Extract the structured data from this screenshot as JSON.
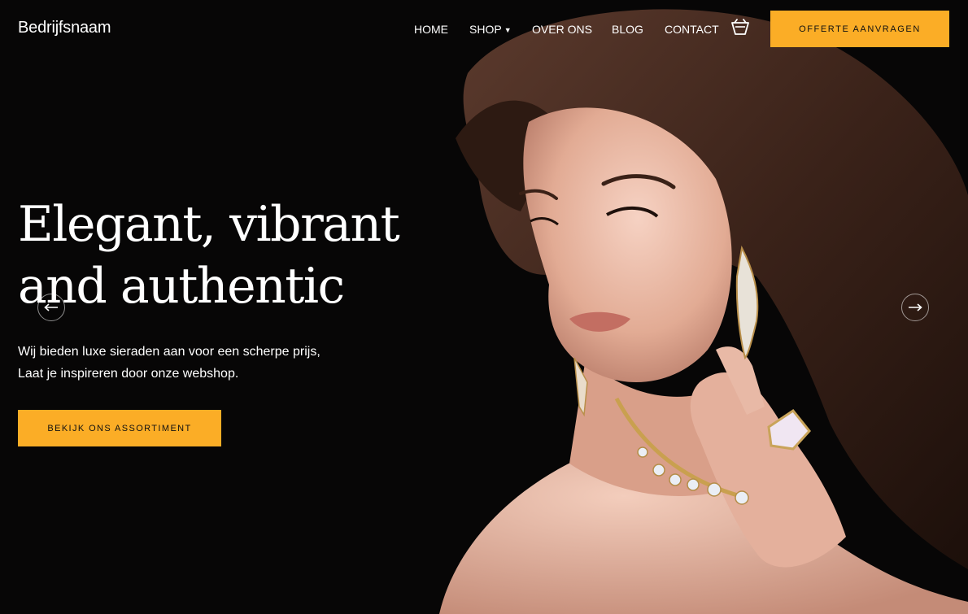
{
  "header": {
    "brand": "Bedrijfsnaam",
    "nav": [
      "HOME",
      "SHOP",
      "OVER ONS",
      "BLOG",
      "CONTACT"
    ],
    "shop_dropdown_icon": "chevron-down-icon",
    "cart_icon": "basket-icon",
    "cta_label": "OFFERTE AANVRAGEN"
  },
  "hero": {
    "headline_line1": "Elegant, vibrant",
    "headline_line2": "and authentic",
    "sub_line1": "Wij bieden luxe sieraden aan voor een scherpe prijs,",
    "sub_line2": "Laat je inspireren door onze webshop.",
    "cta_label": "BEKIJK ONS ASSORTIMENT",
    "prev_icon": "arrow-left-icon",
    "next_icon": "arrow-right-icon"
  },
  "colors": {
    "accent": "#fbad26",
    "background": "#070606",
    "text": "#ffffff"
  }
}
